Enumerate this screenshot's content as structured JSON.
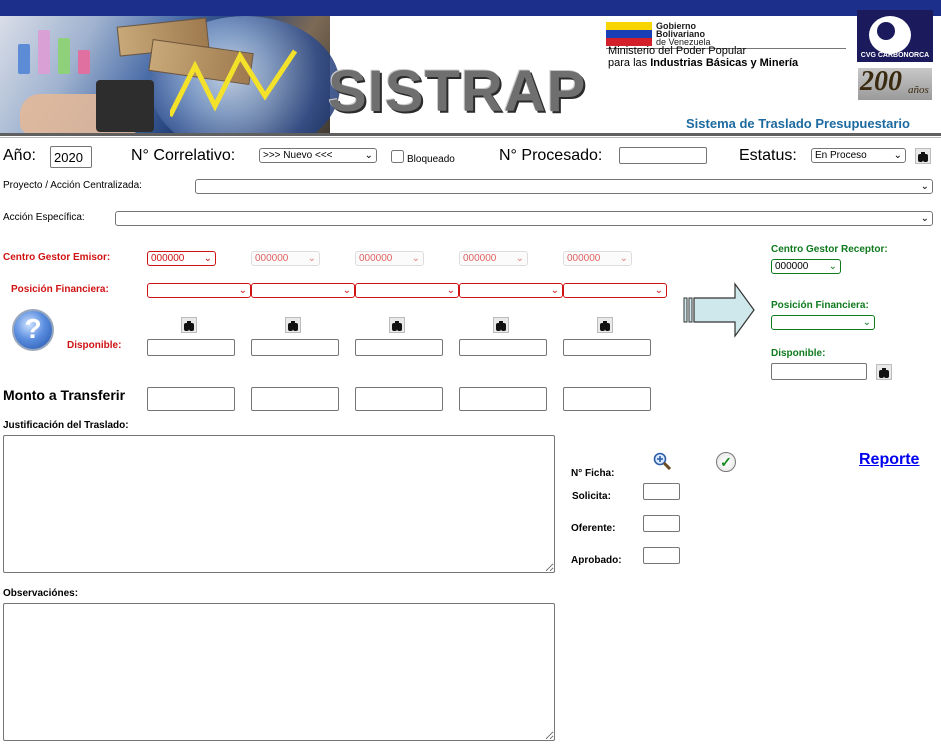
{
  "header": {
    "app_name": "SISTRAP",
    "subtitle": "Sistema de Traslado Presupuestario",
    "gov_line1": "Gobierno",
    "gov_line2": "Bolivariano",
    "gov_line3": "de Venezuela",
    "ministry_line1": "Ministerio del Poder Popular",
    "ministry_line2_a": "para las ",
    "ministry_line2_b": "Industrias Básicas y Minería",
    "logo_label": "CVG CARBONORCA",
    "anniversary_number": "200",
    "anniversary_word": "años"
  },
  "form": {
    "anio_label": "Año:",
    "anio_value": "2020",
    "correlativo_label": "N° Correlativo:",
    "correlativo_value": ">>> Nuevo <<<",
    "bloqueado_label": "Bloqueado",
    "procesado_label": "N° Procesado:",
    "procesado_value": "",
    "estatus_label": "Estatus:",
    "estatus_value": "En Proceso",
    "proyecto_label": "Proyecto / Acción Centralizada:",
    "proyecto_value": "",
    "accion_label": "Acción Específica:",
    "accion_value": "",
    "centro_emisor_label": "Centro Gestor Emisor:",
    "centro_emisor_values": [
      "000000",
      "000000",
      "000000",
      "000000",
      "000000"
    ],
    "posicion_label": "Posición Financiera:",
    "disponible_label": "Disponible:",
    "monto_label": "Monto a Transferir",
    "receptor_label": "Centro Gestor Receptor:",
    "receptor_value": "000000",
    "receptor_posicion_label": "Posición Financiera:",
    "receptor_disponible_label": "Disponible:",
    "justificacion_label": "Justificación del Traslado:",
    "observaciones_label": "Observaciónes:",
    "ficha_label": "N° Ficha:",
    "solicita_label": "Solicita:",
    "oferente_label": "Oferente:",
    "aprobado_label": "Aprobado:",
    "reporte_link": "Reporte"
  },
  "colors": {
    "emisor_red": "#d01212",
    "receptor_green": "#0e7a1d",
    "subtitle_blue": "#1d6aa0",
    "link_blue": "#0000ee"
  },
  "icons": {
    "search": "binoculars-icon",
    "help": "help-icon",
    "arrow": "transfer-arrow-icon",
    "zoom": "zoom-in-icon",
    "check": "check-icon"
  }
}
